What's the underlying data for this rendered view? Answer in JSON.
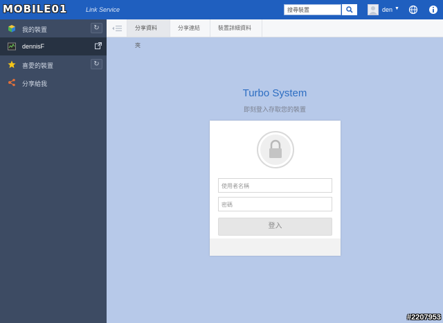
{
  "header": {
    "logo_text": "MOBILE01",
    "service": "Link Service",
    "search_text": "搜尋裝置",
    "user": "den"
  },
  "sidebar": {
    "my_devices": "我的裝置",
    "device_name": "dennisF",
    "favorites": "喜愛的裝置",
    "shared_with_me": "分享給我"
  },
  "toolbar": {
    "tabs": [
      "分享資料夾",
      "分享連結",
      "裝置詳細資料"
    ]
  },
  "login": {
    "title": "Turbo System",
    "subtitle": "即刻登入存取您的裝置",
    "username_placeholder": "使用者名稱",
    "password_placeholder": "密碼",
    "login_label": "登入"
  },
  "watermark": "#2207953",
  "colors": {
    "header_bg": "#1f5fbf",
    "sidebar_bg": "#3d4b63",
    "content_bg": "#b7c9e9",
    "title": "#2d6ec2"
  }
}
